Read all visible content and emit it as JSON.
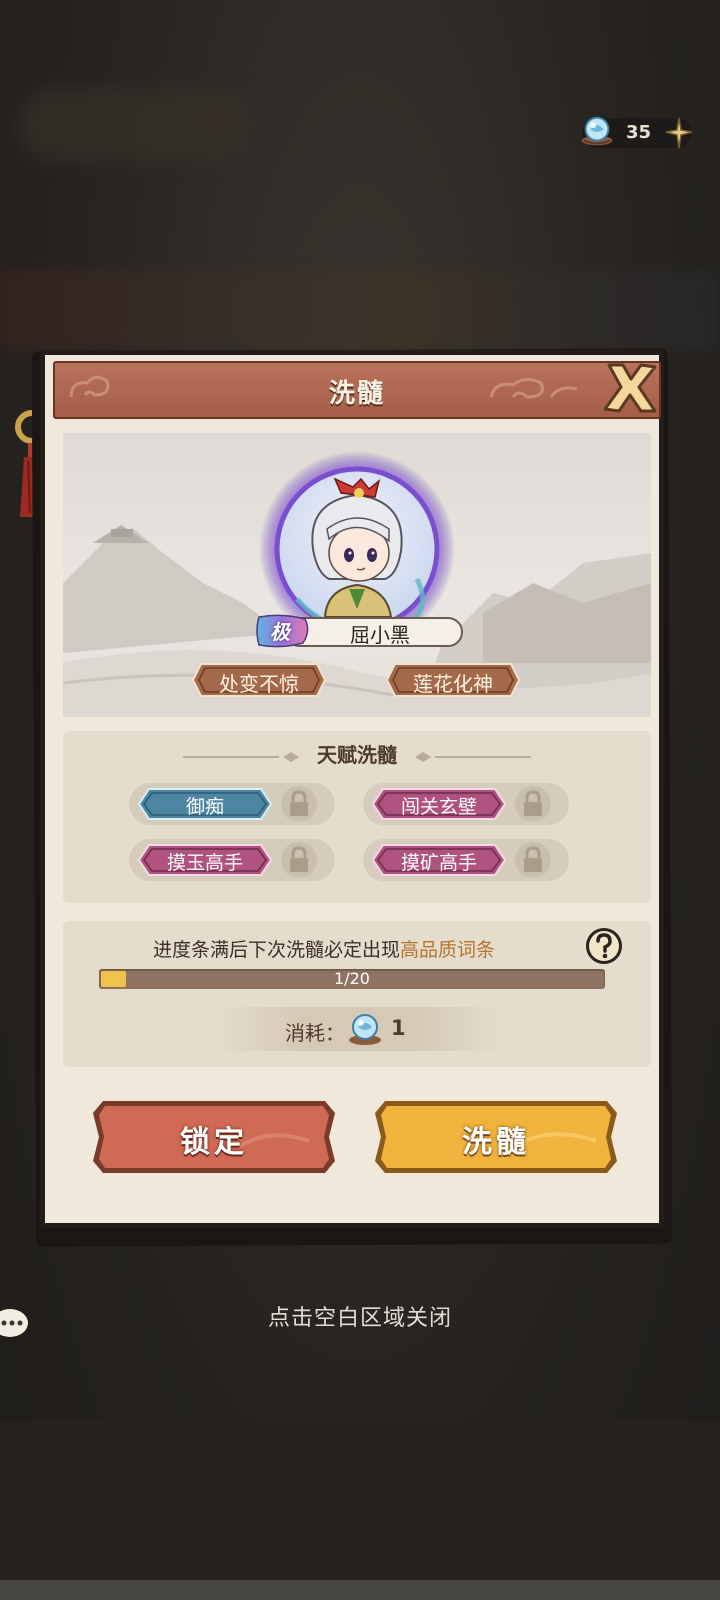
{
  "currency": {
    "amount": "35",
    "icon": "spirit-gem-icon",
    "add_icon": "plus-icon"
  },
  "dialog": {
    "title": "洗髓",
    "hero": {
      "rank": "极",
      "name": "屈小黑",
      "traits": [
        "处变不惊",
        "莲花化神"
      ]
    },
    "talents": {
      "title": "天赋洗髓",
      "items": [
        {
          "label": "御痴",
          "color": "#4d86a3"
        },
        {
          "label": "闯关玄壁",
          "color": "#b0527f"
        },
        {
          "label": "摸玉高手",
          "color": "#b0527f"
        },
        {
          "label": "摸矿高手",
          "color": "#b0527f"
        }
      ]
    },
    "progress": {
      "hint_prefix": "进度条满后下次洗髓必定出现",
      "hint_highlight": "高品质词条",
      "current": 1,
      "max": 20,
      "label": "1/20"
    },
    "cost": {
      "label": "消耗：",
      "amount": "1"
    },
    "buttons": {
      "lock": "锁定",
      "wash": "洗髓"
    }
  },
  "close_hint": "点击空白区域关闭",
  "colors": {
    "header": "#a55d48",
    "lock_button": "#cf6a55",
    "wash_button": "#f0b33d",
    "highlight_text": "#b5752f"
  }
}
